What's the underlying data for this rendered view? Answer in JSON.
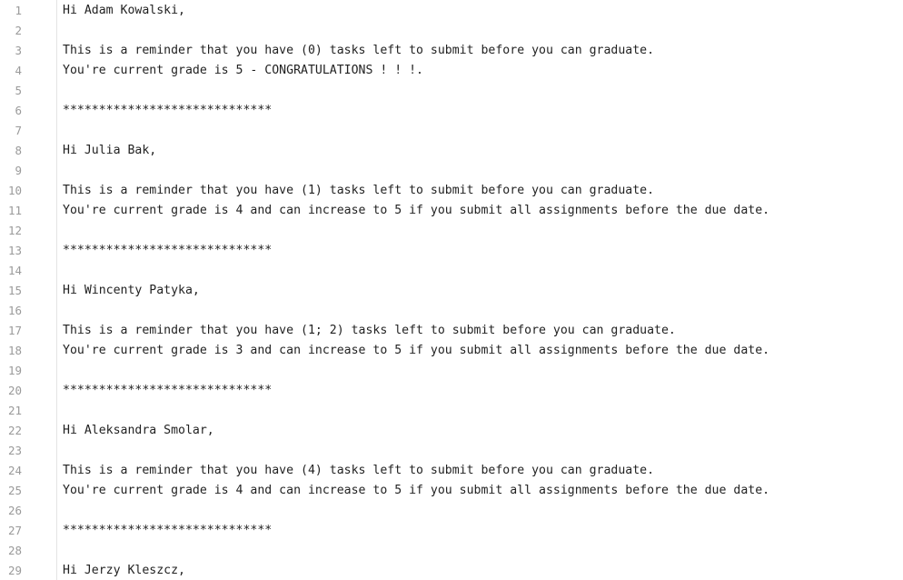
{
  "editor": {
    "lines": [
      {
        "num": "1",
        "text": "Hi Adam Kowalski,"
      },
      {
        "num": "2",
        "text": ""
      },
      {
        "num": "3",
        "text": "This is a reminder that you have (0) tasks left to submit before you can graduate."
      },
      {
        "num": "4",
        "text": "You're current grade is 5 - CONGRATULATIONS ! ! !."
      },
      {
        "num": "5",
        "text": ""
      },
      {
        "num": "6",
        "text": "*****************************"
      },
      {
        "num": "7",
        "text": ""
      },
      {
        "num": "8",
        "text": "Hi Julia Bak,"
      },
      {
        "num": "9",
        "text": ""
      },
      {
        "num": "10",
        "text": "This is a reminder that you have (1) tasks left to submit before you can graduate."
      },
      {
        "num": "11",
        "text": "You're current grade is 4 and can increase to 5 if you submit all assignments before the due date."
      },
      {
        "num": "12",
        "text": ""
      },
      {
        "num": "13",
        "text": "*****************************"
      },
      {
        "num": "14",
        "text": ""
      },
      {
        "num": "15",
        "text": "Hi Wincenty Patyka,"
      },
      {
        "num": "16",
        "text": ""
      },
      {
        "num": "17",
        "text": "This is a reminder that you have (1; 2) tasks left to submit before you can graduate."
      },
      {
        "num": "18",
        "text": "You're current grade is 3 and can increase to 5 if you submit all assignments before the due date."
      },
      {
        "num": "19",
        "text": ""
      },
      {
        "num": "20",
        "text": "*****************************"
      },
      {
        "num": "21",
        "text": ""
      },
      {
        "num": "22",
        "text": "Hi Aleksandra Smolar,"
      },
      {
        "num": "23",
        "text": ""
      },
      {
        "num": "24",
        "text": "This is a reminder that you have (4) tasks left to submit before you can graduate."
      },
      {
        "num": "25",
        "text": "You're current grade is 4 and can increase to 5 if you submit all assignments before the due date."
      },
      {
        "num": "26",
        "text": ""
      },
      {
        "num": "27",
        "text": "*****************************"
      },
      {
        "num": "28",
        "text": ""
      },
      {
        "num": "29",
        "text": "Hi Jerzy Kleszcz,"
      }
    ]
  }
}
